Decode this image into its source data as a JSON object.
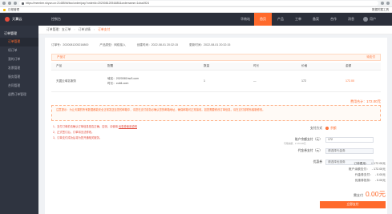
{
  "browser": {
    "url": "https://member.shyun.cn:21485/fd/bcc/order/pay?orderId=20200812051680&ordername=1cba4924",
    "bookmark_left": "日程管理",
    "bookmark_right": "数据挖掘工具"
  },
  "header": {
    "logo": "天翼云",
    "left_item": "控制台",
    "nav": [
      "华南站",
      "首页",
      "产品",
      "工单",
      "备案",
      "合作",
      "消息"
    ],
    "active_nav": "首页",
    "user": "用户"
  },
  "sidebar": {
    "head": "订单管理",
    "items": [
      {
        "label": "订单管理",
        "active": true
      },
      {
        "label": "续订单"
      },
      {
        "label": "我的订单"
      },
      {
        "label": "发票管理"
      },
      {
        "label": "服务管理"
      },
      {
        "label": "合同管理"
      },
      {
        "label": "退费订单管理"
      }
    ]
  },
  "breadcrumb": [
    "订单管理：支订单",
    "订单详情",
    "订单支付"
  ],
  "order": {
    "no": "订单号：2020081205216800",
    "product": "产品类型：网络接入",
    "created": "创建时间：2022-08-01 20:32:15",
    "updated": "更新时间：2022-08-01 20:32:15",
    "status": "产品订",
    "status_right": "待支付"
  },
  "table": {
    "headers": [
      "产品",
      "配置",
      "数量",
      "时长",
      "价格",
      "金额"
    ],
    "rows": [
      {
        "product": "天翼云域名服务",
        "spec1": "域名：2020081hw3.com",
        "spec2": "时长：cubit-com",
        "qty": "1",
        "duration": "—",
        "price": "172",
        "amount": "172.00"
      }
    ]
  },
  "total": {
    "label": "费用合计：",
    "amount": "172.00元"
  },
  "notice": "注意提示：为让天翼的所有数据都能安全正常发送至您的邮箱中，请您在支付前务必确认您的邮箱地址，确保邮箱可正常接收。如您需要修改订单信息，请在支付前联系客服修改。",
  "notes": [
    "1、支付订单前请确认订单信息是否正确。否则，请使用",
    "2、正式签订后，订单将无法修改。",
    "3、订单支付成功后将为您开通相关服务。"
  ],
  "notes_link": "优惠券使用说明",
  "pay": {
    "method_label": "支付方式",
    "method_value": "余额",
    "balance_label": "账户余额支付（元）",
    "balance_value": "172",
    "balance_hint": "可用余额：¥ 172.00元",
    "voucher_label": "代金券支付（元）",
    "voucher_placeholder": "请选择代金券",
    "coupon_label": "优惠券",
    "coupon_placeholder": "请选择优惠券"
  },
  "summary": [
    {
      "label": "订单费用：",
      "value": "+ 172.00元"
    },
    {
      "label": "账户余额支付：",
      "value": "- 172.00元"
    },
    {
      "label": "代金券支付：",
      "value": "- 0.00元"
    },
    {
      "label": "优惠券抵扣：",
      "value": "- 0.00元"
    }
  ],
  "due": {
    "label": "需支付",
    "amount": "0.00元"
  },
  "submit_label": "立即支付"
}
